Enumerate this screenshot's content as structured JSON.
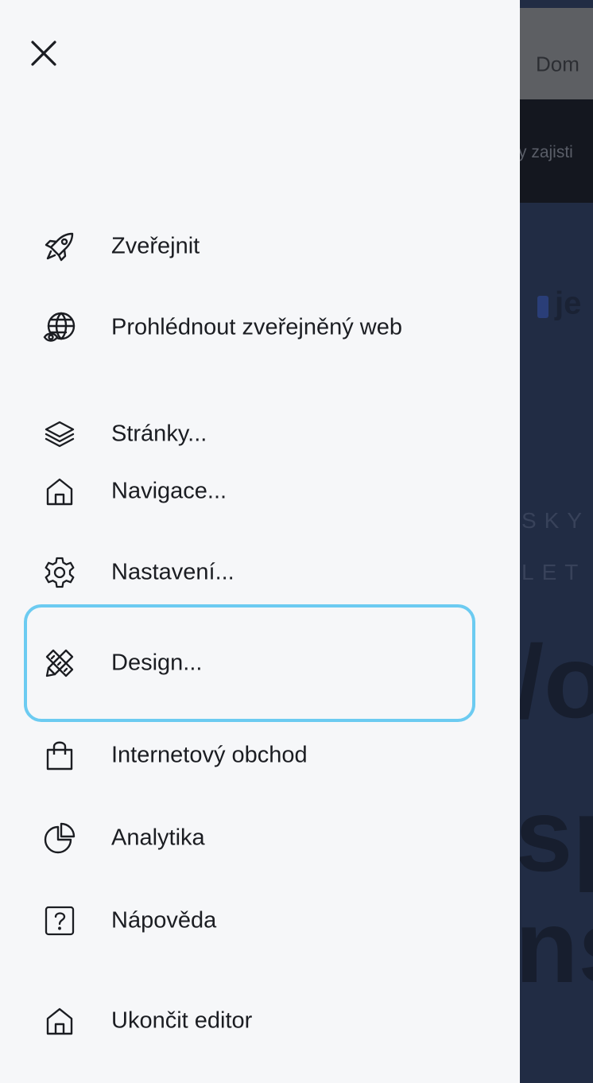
{
  "background_page": {
    "topbar_label": "Dom",
    "banner_text": "y zajisti",
    "logo_text": "je",
    "eyebrow_line1": "SKY",
    "eyebrow_line2": "LET",
    "hero_line1": "/o",
    "hero_line2": "sp",
    "hero_line3": "ns"
  },
  "drawer": {
    "close_icon": "close-icon",
    "items": [
      {
        "label": "Zveřejnit",
        "icon": "rocket-icon"
      },
      {
        "label": "Prohlédnout zveřejněný web",
        "icon": "globe-eye-icon"
      },
      {
        "label": "Stránky...",
        "icon": "layers-icon"
      },
      {
        "label": "Navigace...",
        "icon": "home-icon"
      },
      {
        "label": "Nastavení...",
        "icon": "gear-icon"
      },
      {
        "label": "Design...",
        "icon": "design-tools-icon",
        "active": true
      },
      {
        "label": "Internetový obchod",
        "icon": "shopping-bag-icon"
      },
      {
        "label": "Analytika",
        "icon": "pie-chart-icon"
      },
      {
        "label": "Nápověda",
        "icon": "help-icon"
      },
      {
        "label": "Ukončit editor",
        "icon": "exit-home-icon"
      }
    ]
  },
  "colors": {
    "drawer_bg": "#f6f7f9",
    "active_border": "#6ccbf1",
    "text": "#1b1d22",
    "overlay": "#212c44"
  }
}
